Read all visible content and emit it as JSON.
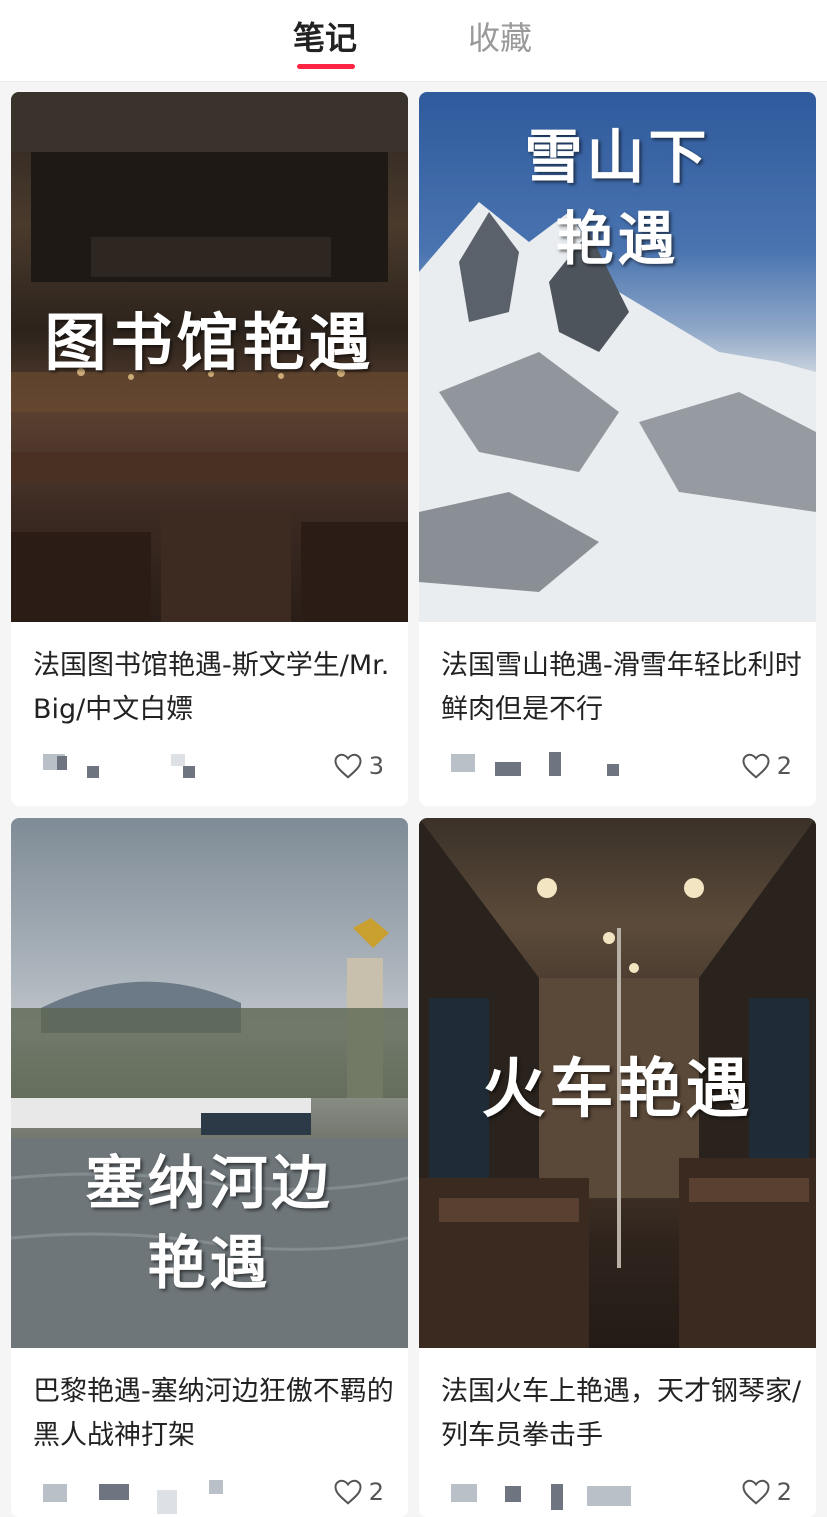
{
  "tabs": [
    {
      "label": "笔记",
      "active": true
    },
    {
      "label": "收藏",
      "active": false
    }
  ],
  "notes": [
    {
      "cover_text": "图书馆艳遇",
      "title": "法国图书馆艳遇-斯文学生/Mr. Big/中文白嫖",
      "likes": "3"
    },
    {
      "cover_text_line1": "雪山下",
      "cover_text_line2": "艳遇",
      "title": "法国雪山艳遇-滑雪年轻比利时鲜肉但是不行",
      "likes": "2"
    },
    {
      "cover_text_line1": "塞纳河边",
      "cover_text_line2": "艳遇",
      "title": "巴黎艳遇-塞纳河边狂傲不羁的黑人战神打架",
      "likes": "2"
    },
    {
      "cover_text": "火车艳遇",
      "title": "法国火车上艳遇，天才钢琴家/列车员拳击手",
      "likes": "2"
    }
  ],
  "colors": {
    "accent": "#ff2442",
    "text": "#222222",
    "muted": "#9a9a9a"
  },
  "icons": {
    "like": "heart-outline-icon"
  }
}
